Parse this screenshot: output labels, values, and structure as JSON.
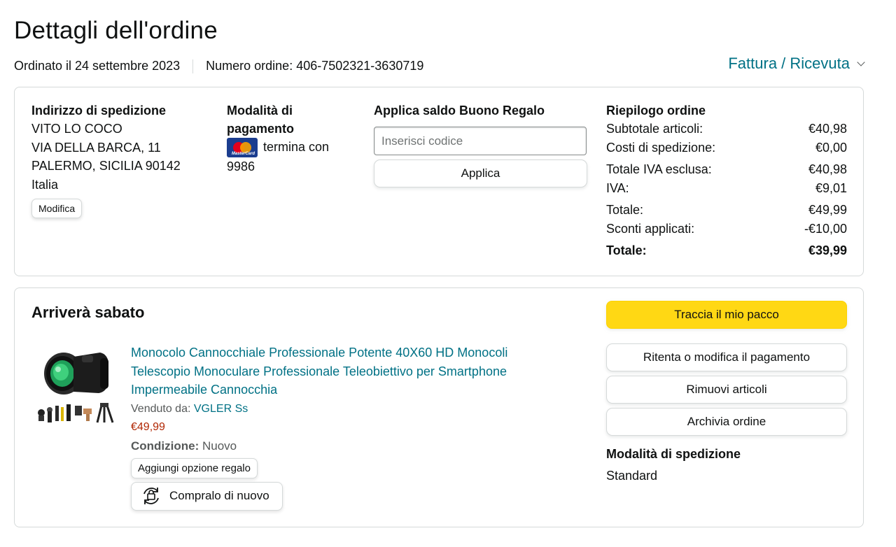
{
  "page": {
    "title": "Dettagli dell'ordine",
    "ordered_on": "Ordinato il 24 settembre 2023",
    "order_number": "Numero ordine: 406-7502321-3630719",
    "invoice_link": "Fattura / Ricevuta"
  },
  "shipping_address": {
    "heading": "Indirizzo di spedizione",
    "name": "VITO LO COCO",
    "street": "VIA DELLA BARCA, 11",
    "city": "PALERMO, SICILIA 90142",
    "country": "Italia",
    "edit_label": "Modifica"
  },
  "payment": {
    "heading": "Modalità di pagamento",
    "card_brand": "MasterCard",
    "ends_with_label": "termina con",
    "last_digits": "9986"
  },
  "gift_card": {
    "heading": "Applica saldo Buono Regalo",
    "placeholder": "Inserisci codice",
    "apply_label": "Applica"
  },
  "summary": {
    "heading": "Riepilogo ordine",
    "rows": [
      {
        "label": "Subtotale articoli:",
        "value": "€40,98"
      },
      {
        "label": "Costi di spedizione:",
        "value": "€0,00"
      },
      {
        "label": "Totale IVA esclusa:",
        "value": "€40,98"
      },
      {
        "label": "IVA:",
        "value": "€9,01"
      },
      {
        "label": "Totale:",
        "value": "€49,99"
      },
      {
        "label": "Sconti applicati:",
        "value": "-€10,00"
      }
    ],
    "grand_total_label": "Totale:",
    "grand_total_value": "€39,99"
  },
  "shipment": {
    "status": "Arriverà sabato",
    "product": {
      "title": "Monocolo Cannocchiale Professionale Potente 40X60 HD Monocoli Telescopio Monoculare Professionale Teleobiettivo per Smartphone Impermeabile Cannocchia",
      "sold_by_label": "Venduto da:",
      "seller": "VGLER Ss",
      "price": "€49,99",
      "condition_label": "Condizione:",
      "condition_value": "Nuovo",
      "gift_option_label": "Aggiungi opzione regalo",
      "buy_again_label": "Compralo di nuovo"
    },
    "actions": {
      "track": "Traccia il mio pacco",
      "retry_payment": "Ritenta o modifica il pagamento",
      "remove_items": "Rimuovi articoli",
      "archive": "Archivia ordine"
    },
    "shipping_method_heading": "Modalità di spedizione",
    "shipping_method_value": "Standard"
  },
  "colors": {
    "link": "#007185",
    "price": "#b12704",
    "primary_button": "#ffd814",
    "border": "#d5d9d9"
  }
}
